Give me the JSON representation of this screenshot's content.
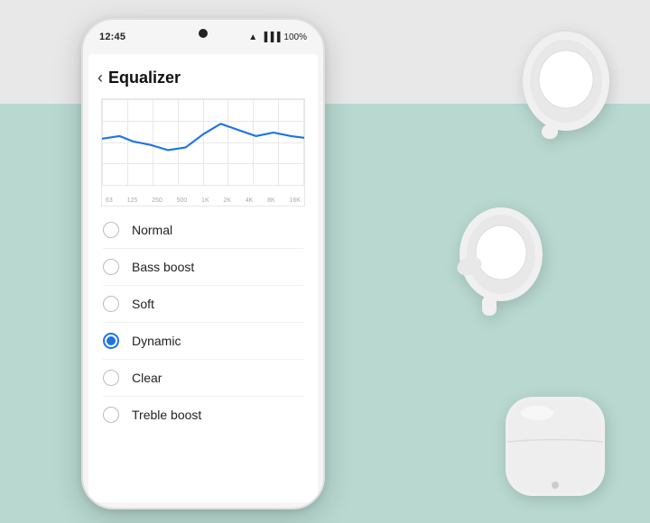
{
  "phone": {
    "time": "12:45",
    "battery": "100%",
    "title": "Equalizer",
    "back_label": "‹"
  },
  "eq_options": [
    {
      "id": "normal",
      "label": "Normal",
      "selected": false
    },
    {
      "id": "bass_boost",
      "label": "Bass boost",
      "selected": false
    },
    {
      "id": "soft",
      "label": "Soft",
      "selected": false
    },
    {
      "id": "dynamic",
      "label": "Dynamic",
      "selected": true
    },
    {
      "id": "clear",
      "label": "Clear",
      "selected": false
    },
    {
      "id": "treble_boost",
      "label": "Treble boost",
      "selected": false
    }
  ],
  "freq_labels": [
    "63",
    "125",
    "250",
    "500",
    "1K",
    "2K",
    "4K",
    "8K",
    "16K"
  ],
  "colors": {
    "accent": "#1a73e8",
    "bg_top": "#e8e8e8",
    "bg_bottom": "#b8d8d0",
    "phone_bg": "#f5f5f5"
  }
}
